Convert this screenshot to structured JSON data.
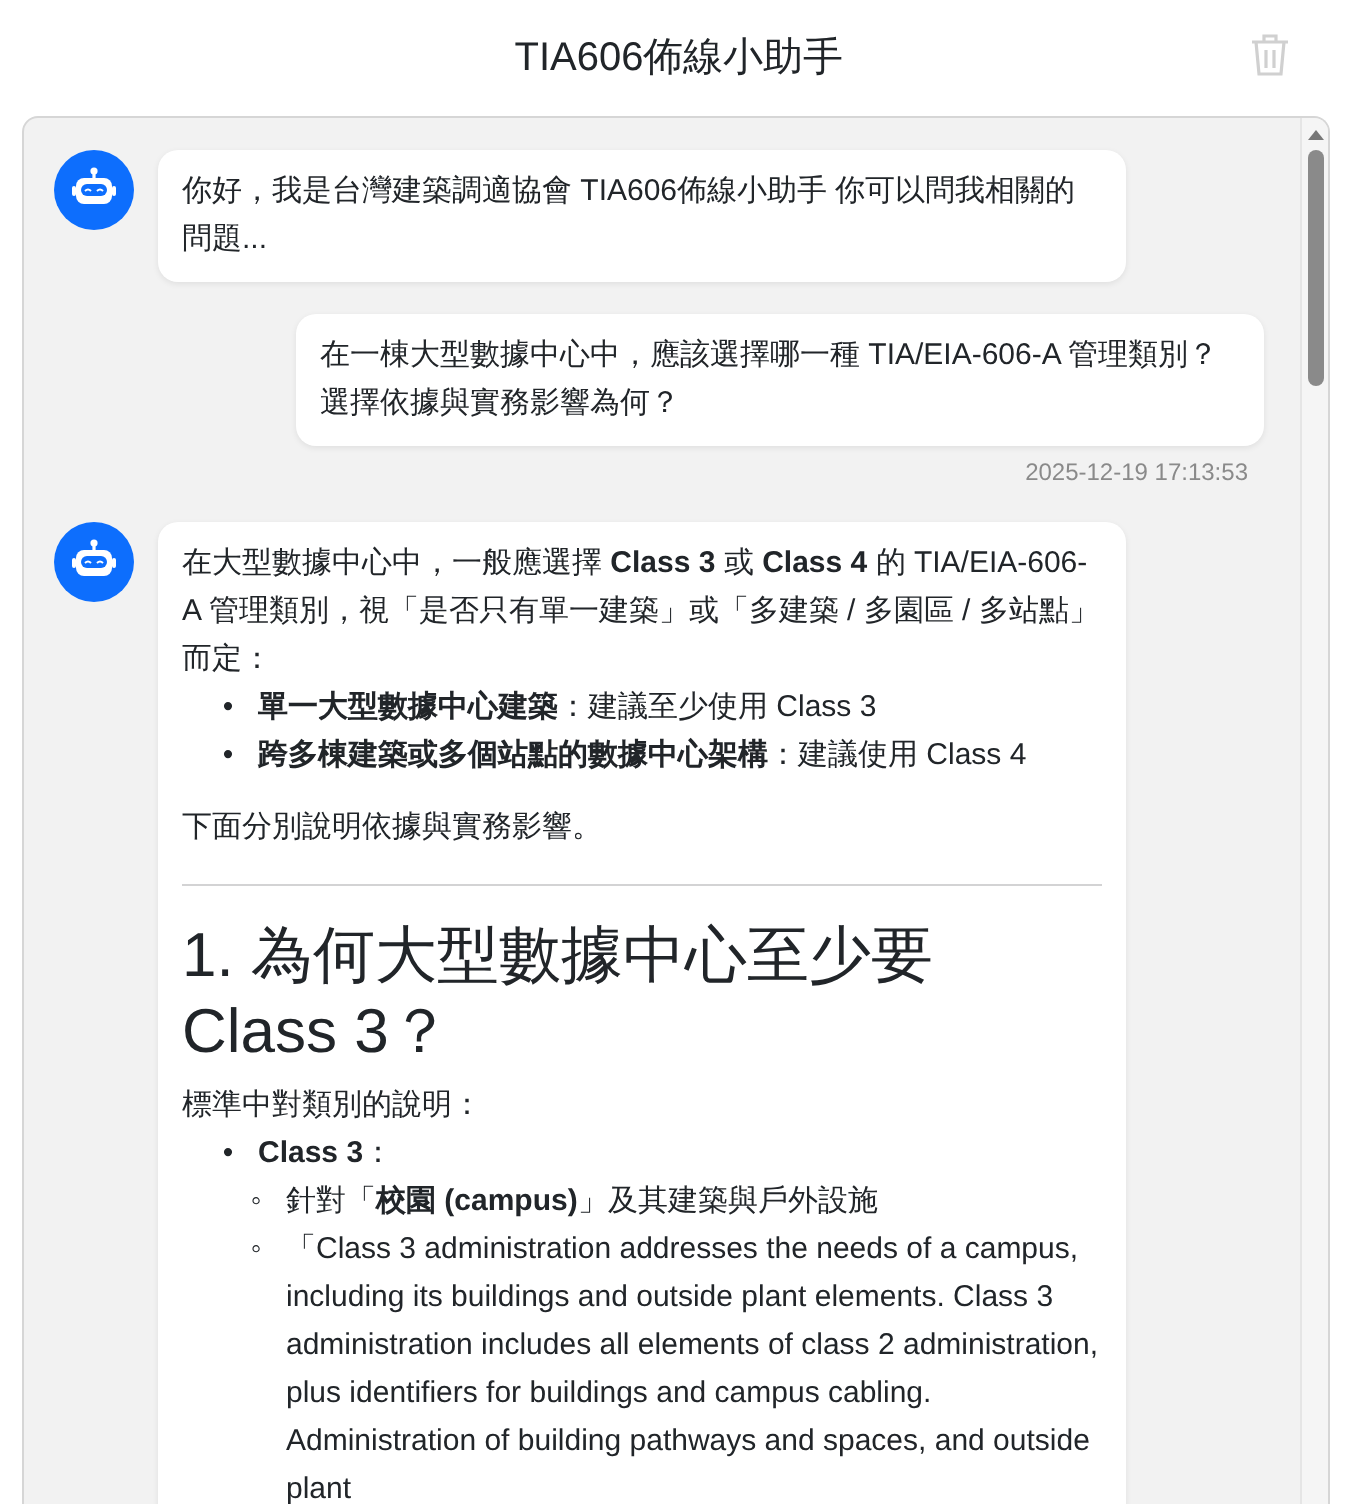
{
  "header": {
    "title": "TIA606佈線小助手"
  },
  "messages": [
    {
      "kind": "bot",
      "blocks": [
        {
          "kind": "p",
          "text": "你好，我是台灣建築調適協會 TIA606佈線小助手 你可以問我相關的問題..."
        }
      ]
    },
    {
      "kind": "user",
      "text": "在一棟大型數據中心中，應該選擇哪一種 TIA/EIA-606-A 管理類別？選擇依據與實務影響為何？",
      "time": "2025-12-19 17:13:53"
    },
    {
      "kind": "bot",
      "blocks": [
        {
          "kind": "p",
          "text": "在大型數據中心中，一般應選擇 **Class 3** 或 **Class 4** 的 TIA/EIA-606-A 管理類別，視「是否只有單一建築」或「多建築 / 多園區 / 多站點」而定："
        },
        {
          "kind": "ul",
          "items": [
            {
              "marker": "•",
              "text": "**單一大型數據中心建築**：建議至少使用 Class 3"
            },
            {
              "marker": "•",
              "text": "**跨多棟建築或多個站點的數據中心架構**：建議使用 Class 4"
            }
          ]
        },
        {
          "kind": "p",
          "text": "下面分別說明依據與實務影響。"
        },
        {
          "kind": "hr"
        },
        {
          "kind": "h",
          "text": "1. 為何大型數據中心至少要 Class 3？"
        },
        {
          "kind": "p",
          "text": "標準中對類別的說明："
        },
        {
          "kind": "ul",
          "items": [
            {
              "marker": "•",
              "text": "**Class 3**：",
              "children": [
                {
                  "marker": "◦",
                  "text": "針對「**校園 (campus)**」及其建築與戶外設施"
                },
                {
                  "marker": "◦",
                  "text": "「Class 3 administration addresses the needs of a campus, including its buildings and outside plant elements. Class 3 administration includes all elements of class 2 administration, plus identifiers for buildings and campus cabling. Administration of building pathways and spaces, and outside plant"
                }
              ]
            }
          ]
        }
      ]
    }
  ]
}
